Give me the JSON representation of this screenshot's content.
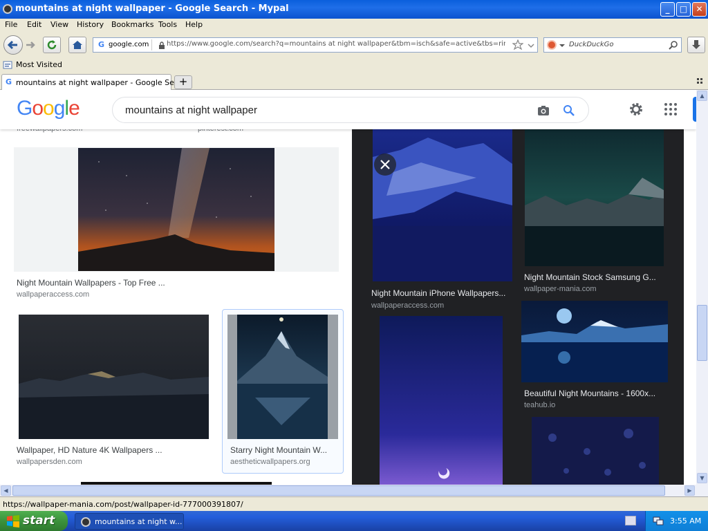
{
  "window": {
    "title": "mountains at night wallpaper - Google Search - Mypal",
    "controls": [
      "_",
      "□",
      "✕"
    ]
  },
  "menu": [
    "File",
    "Edit",
    "View",
    "History",
    "Bookmarks",
    "Tools",
    "Help"
  ],
  "nav": {
    "site_identity": "google.com",
    "url": "https://www.google.com/search?q=mountains at night wallpaper&tbm=isch&safe=active&tbs=rimg:CS",
    "search_engine_placeholder": "DuckDuckGo"
  },
  "bookmarks": {
    "most_visited": "Most Visited"
  },
  "tabs": [
    {
      "label": "mountains at night wallpaper - Google Search"
    }
  ],
  "google": {
    "query": "mountains at night wallpaper",
    "logo_letters": [
      {
        "ch": "G",
        "color": "#4285f4"
      },
      {
        "ch": "o",
        "color": "#ea4335"
      },
      {
        "ch": "o",
        "color": "#fbbc05"
      },
      {
        "ch": "g",
        "color": "#4285f4"
      },
      {
        "ch": "l",
        "color": "#34a853"
      },
      {
        "ch": "e",
        "color": "#ea4335"
      }
    ]
  },
  "results": {
    "top_partial": [
      {
        "source": "freewallpapers.com"
      },
      {
        "source": "pinterest.com"
      }
    ],
    "left": [
      {
        "title": "Night Mountain Wallpapers - Top Free ...",
        "source": "wallpaperaccess.com"
      },
      {
        "title": "Wallpaper, HD Nature 4K Wallpapers ...",
        "source": "wallpapersden.com"
      },
      {
        "title": "Starry Night Mountain W...",
        "source": "aestheticwallpapers.org"
      }
    ],
    "right": [
      {
        "title": "Night Mountain iPhone Wallpapers...",
        "source": "wallpaperaccess.com"
      },
      {
        "title": "Night Mountain Stock Samsung G...",
        "source": "wallpaper-mania.com"
      },
      {
        "title": "Beautiful Night Mountains - 1600x...",
        "source": "teahub.io"
      }
    ]
  },
  "status": {
    "link": "https://wallpaper-mania.com/post/wallpaper-id-777000391807/"
  },
  "taskbar": {
    "start": "start",
    "task": "mountains at night w...",
    "clock": "3:55 AM"
  },
  "colors": {
    "titlebar": "#0b53cf",
    "chrome": "#ece9d8",
    "google_blue": "#1a73e8",
    "preview_bg": "#202124"
  }
}
